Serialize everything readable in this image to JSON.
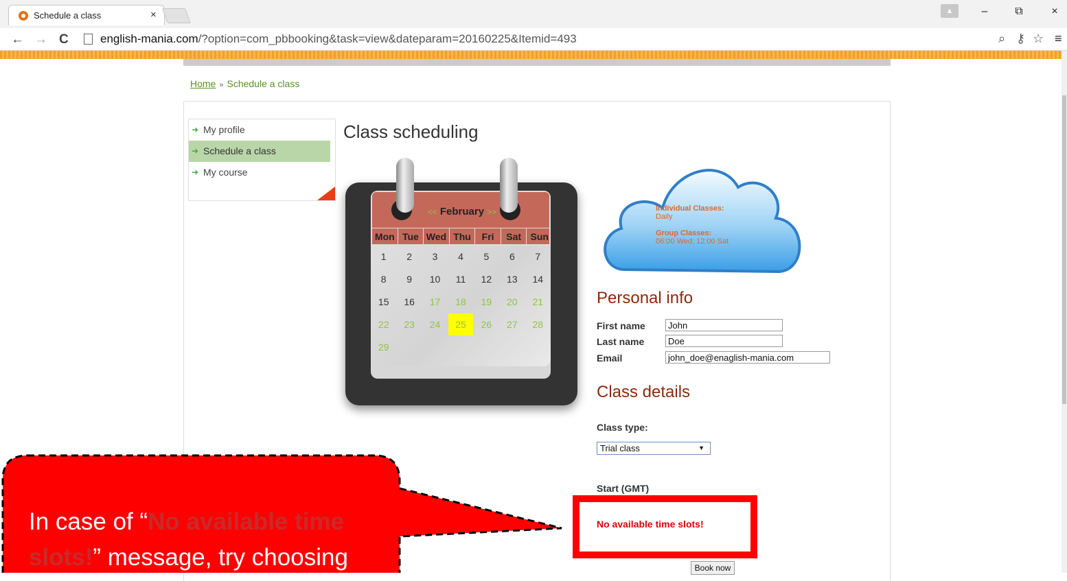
{
  "browser": {
    "tab_title": "Schedule a class",
    "tab_close": "×",
    "url_domain": "english-mania.com",
    "url_path": "/?option=com_pbbooking&task=view&dateparam=20160225&Itemid=493",
    "win_minimize": "–",
    "win_restore": "⧉",
    "win_close": "×",
    "back": "←",
    "forward": "→",
    "reload": "C",
    "zoom_icon": "⌕",
    "key_icon": "⚷",
    "star_icon": "☆",
    "menu_icon": "≡"
  },
  "breadcrumb": {
    "home": "Home",
    "separator": "»",
    "current": "Schedule a class"
  },
  "side_menu": {
    "items": [
      {
        "label": "My profile",
        "active": false
      },
      {
        "label": "Schedule a class",
        "active": true
      },
      {
        "label": "My course",
        "active": false
      }
    ],
    "arrow": "➜"
  },
  "page": {
    "heading": "Class scheduling"
  },
  "calendar": {
    "prev": "<<",
    "month": "February",
    "next": ">>",
    "weekdays": [
      "Mon",
      "Tue",
      "Wed",
      "Thu",
      "Fri",
      "Sat",
      "Sun"
    ],
    "weeks": [
      [
        "1",
        "2",
        "3",
        "4",
        "5",
        "6",
        "7"
      ],
      [
        "8",
        "9",
        "10",
        "11",
        "12",
        "13",
        "14"
      ],
      [
        "15",
        "16",
        "17",
        "18",
        "19",
        "20",
        "21"
      ],
      [
        "22",
        "23",
        "24",
        "25",
        "26",
        "27",
        "28"
      ],
      [
        "29",
        "",
        "",
        "",
        "",
        "",
        ""
      ]
    ],
    "available_from": 17,
    "selected_day": 25
  },
  "cloud": {
    "individual_label": "Individual Classes:",
    "individual_value": "Daily",
    "group_label": "Group Classes:",
    "group_value": "06:00 Wed; 12:00 Sat"
  },
  "personal_info": {
    "title": "Personal info",
    "first_name_label": "First name",
    "first_name_value": "John",
    "last_name_label": "Last name",
    "last_name_value": "Doe",
    "email_label": "Email",
    "email_value": "john_doe@enaglish-mania.com"
  },
  "class_details": {
    "title": "Class details",
    "class_type_label": "Class type:",
    "class_type_value": "Trial class",
    "start_label": "Start (GMT)",
    "no_slots": "No available time slots!",
    "book_button": "Book now"
  },
  "callout": {
    "text_before": "In case of “",
    "highlight": "No available time slots!",
    "text_after": "” message, try choosing"
  },
  "colors": {
    "accent_green": "#8dc63f",
    "callout_red": "#ff0000",
    "section_title": "#8a2a0e",
    "calendar_header": "#c4685a"
  }
}
